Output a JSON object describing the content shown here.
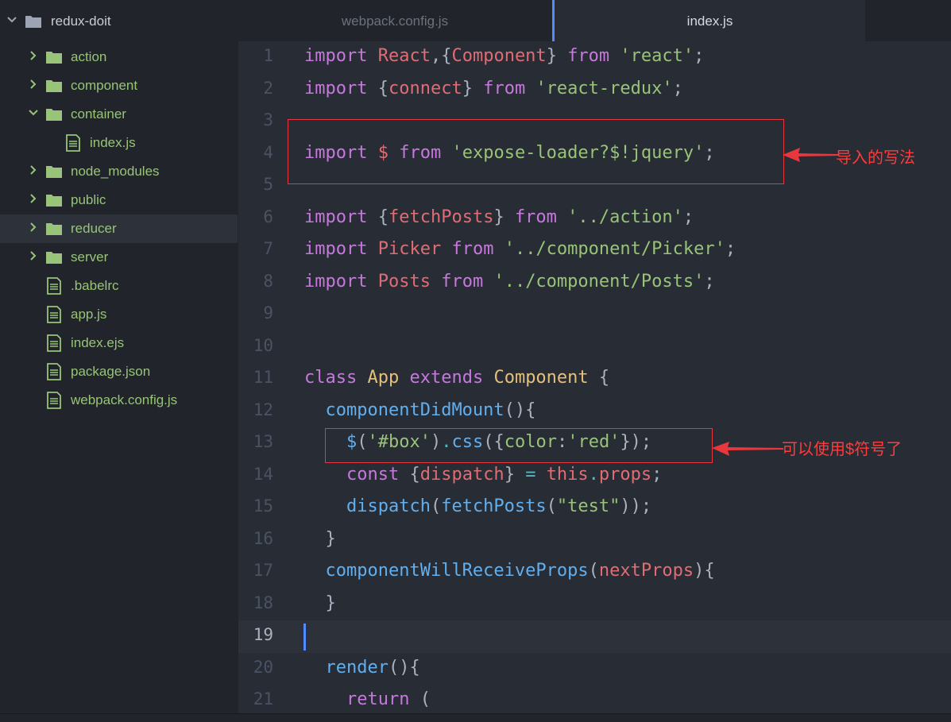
{
  "sidebar": {
    "project_name": "redux-doit",
    "items": [
      {
        "label": "action",
        "type": "folder",
        "expanded": false
      },
      {
        "label": "component",
        "type": "folder",
        "expanded": false
      },
      {
        "label": "container",
        "type": "folder",
        "expanded": true
      },
      {
        "label": "index.js",
        "type": "file",
        "nested": true
      },
      {
        "label": "node_modules",
        "type": "folder",
        "expanded": false
      },
      {
        "label": "public",
        "type": "folder",
        "expanded": false
      },
      {
        "label": "reducer",
        "type": "folder",
        "expanded": false,
        "selected": true
      },
      {
        "label": "server",
        "type": "folder",
        "expanded": false
      },
      {
        "label": ".babelrc",
        "type": "file"
      },
      {
        "label": "app.js",
        "type": "file"
      },
      {
        "label": "index.ejs",
        "type": "file"
      },
      {
        "label": "package.json",
        "type": "file"
      },
      {
        "label": "webpack.config.js",
        "type": "file"
      }
    ]
  },
  "tabs": [
    {
      "label": "webpack.config.js",
      "active": false
    },
    {
      "label": "index.js",
      "active": true
    }
  ],
  "editor": {
    "current_line": 19,
    "lines": [
      {
        "num": "1",
        "tokens": [
          [
            "kw",
            "import"
          ],
          [
            "pn",
            " "
          ],
          [
            "var",
            "React"
          ],
          [
            "pn",
            ",{"
          ],
          [
            "var",
            "Component"
          ],
          [
            "pn",
            "} "
          ],
          [
            "kw",
            "from"
          ],
          [
            "pn",
            " "
          ],
          [
            "str",
            "'react'"
          ],
          [
            "pn",
            ";"
          ]
        ]
      },
      {
        "num": "2",
        "tokens": [
          [
            "kw",
            "import"
          ],
          [
            "pn",
            " {"
          ],
          [
            "var",
            "connect"
          ],
          [
            "pn",
            "} "
          ],
          [
            "kw",
            "from"
          ],
          [
            "pn",
            " "
          ],
          [
            "str",
            "'react-redux'"
          ],
          [
            "pn",
            ";"
          ]
        ]
      },
      {
        "num": "3",
        "tokens": []
      },
      {
        "num": "4",
        "tokens": [
          [
            "kw",
            "import"
          ],
          [
            "pn",
            " "
          ],
          [
            "var",
            "$"
          ],
          [
            "pn",
            " "
          ],
          [
            "kw",
            "from"
          ],
          [
            "pn",
            " "
          ],
          [
            "str",
            "'expose-loader?$!jquery'"
          ],
          [
            "pn",
            ";"
          ]
        ]
      },
      {
        "num": "5",
        "tokens": []
      },
      {
        "num": "6",
        "tokens": [
          [
            "kw",
            "import"
          ],
          [
            "pn",
            " {"
          ],
          [
            "var",
            "fetchPosts"
          ],
          [
            "pn",
            "} "
          ],
          [
            "kw",
            "from"
          ],
          [
            "pn",
            " "
          ],
          [
            "str",
            "'../action'"
          ],
          [
            "pn",
            ";"
          ]
        ]
      },
      {
        "num": "7",
        "tokens": [
          [
            "kw",
            "import"
          ],
          [
            "pn",
            " "
          ],
          [
            "var",
            "Picker"
          ],
          [
            "pn",
            " "
          ],
          [
            "kw",
            "from"
          ],
          [
            "pn",
            " "
          ],
          [
            "str",
            "'../component/Picker'"
          ],
          [
            "pn",
            ";"
          ]
        ]
      },
      {
        "num": "8",
        "tokens": [
          [
            "kw",
            "import"
          ],
          [
            "pn",
            " "
          ],
          [
            "var",
            "Posts"
          ],
          [
            "pn",
            " "
          ],
          [
            "kw",
            "from"
          ],
          [
            "pn",
            " "
          ],
          [
            "str",
            "'../component/Posts'"
          ],
          [
            "pn",
            ";"
          ]
        ]
      },
      {
        "num": "9",
        "tokens": []
      },
      {
        "num": "10",
        "tokens": []
      },
      {
        "num": "11",
        "tokens": [
          [
            "kw",
            "class"
          ],
          [
            "pn",
            " "
          ],
          [
            "cls",
            "App"
          ],
          [
            "pn",
            " "
          ],
          [
            "kw",
            "extends"
          ],
          [
            "pn",
            " "
          ],
          [
            "cls",
            "Component"
          ],
          [
            "pn",
            " {"
          ]
        ]
      },
      {
        "num": "12",
        "tokens": [
          [
            "pn",
            "  "
          ],
          [
            "fn",
            "componentDidMount"
          ],
          [
            "pn",
            "(){"
          ]
        ]
      },
      {
        "num": "13",
        "tokens": [
          [
            "pn",
            "    "
          ],
          [
            "fn",
            "$"
          ],
          [
            "pn",
            "("
          ],
          [
            "str",
            "'#box'"
          ],
          [
            "pn",
            ")"
          ],
          [
            "op",
            "."
          ],
          [
            "fn",
            "css"
          ],
          [
            "pn",
            "({"
          ],
          [
            "str",
            "color"
          ],
          [
            "pn",
            ":"
          ],
          [
            "str",
            "'red'"
          ],
          [
            "pn",
            "});"
          ]
        ]
      },
      {
        "num": "14",
        "tokens": [
          [
            "pn",
            "    "
          ],
          [
            "kw",
            "const"
          ],
          [
            "pn",
            " {"
          ],
          [
            "var",
            "dispatch"
          ],
          [
            "pn",
            "} "
          ],
          [
            "op",
            "="
          ],
          [
            "pn",
            " "
          ],
          [
            "var",
            "this"
          ],
          [
            "op",
            "."
          ],
          [
            "var",
            "props"
          ],
          [
            "pn",
            ";"
          ]
        ]
      },
      {
        "num": "15",
        "tokens": [
          [
            "pn",
            "    "
          ],
          [
            "fn",
            "dispatch"
          ],
          [
            "pn",
            "("
          ],
          [
            "fn",
            "fetchPosts"
          ],
          [
            "pn",
            "("
          ],
          [
            "str",
            "\"test\""
          ],
          [
            "pn",
            "));"
          ]
        ]
      },
      {
        "num": "16",
        "tokens": [
          [
            "pn",
            "  }"
          ]
        ]
      },
      {
        "num": "17",
        "tokens": [
          [
            "pn",
            "  "
          ],
          [
            "fn",
            "componentWillReceiveProps"
          ],
          [
            "pn",
            "("
          ],
          [
            "var",
            "nextProps"
          ],
          [
            "pn",
            "){"
          ]
        ]
      },
      {
        "num": "18",
        "tokens": [
          [
            "pn",
            "  }"
          ]
        ]
      },
      {
        "num": "19",
        "tokens": []
      },
      {
        "num": "20",
        "tokens": [
          [
            "pn",
            "  "
          ],
          [
            "fn",
            "render"
          ],
          [
            "pn",
            "(){"
          ]
        ]
      },
      {
        "num": "21",
        "tokens": [
          [
            "pn",
            "    "
          ],
          [
            "kw",
            "return"
          ],
          [
            "pn",
            " ("
          ]
        ]
      }
    ]
  },
  "annotations": [
    {
      "text": "导入的写法"
    },
    {
      "text": "可以使用$符号了"
    }
  ],
  "colors": {
    "folder_icon": "#98c379",
    "annotation_red": "#e8383d",
    "cursor_blue": "#528bff"
  }
}
